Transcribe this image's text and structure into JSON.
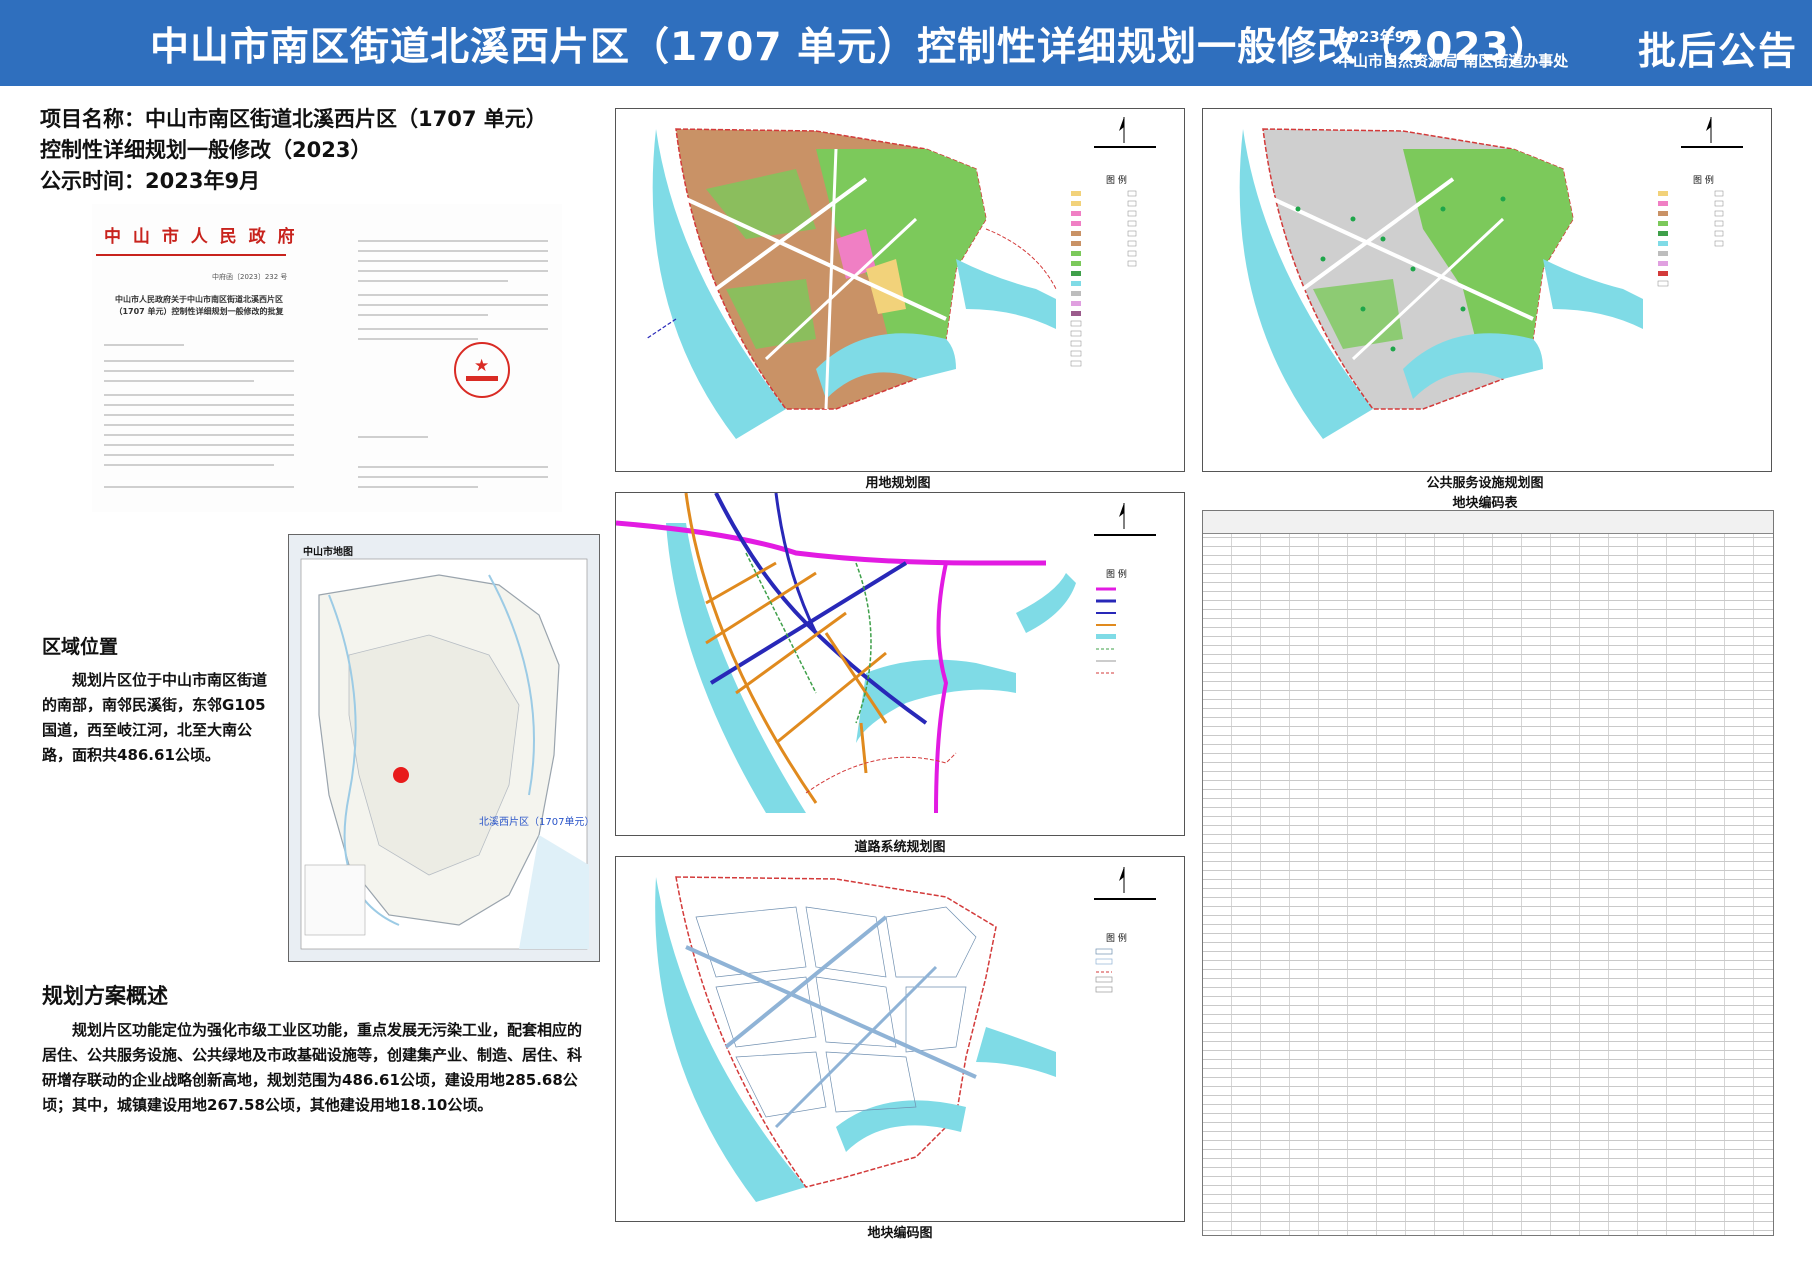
{
  "header": {
    "title": "中山市南区街道北溪西片区（1707 单元）控制性详细规划一般修改（2023）",
    "date": "2023年9月",
    "org": "中山市自然资源局 南区街道办事处",
    "badge": "批后公告"
  },
  "project": {
    "name_line1": "项目名称：中山市南区街道北溪西片区（1707 单元）",
    "name_line2": "控制性详细规划一般修改（2023）",
    "time": "公示时间：2023年9月"
  },
  "document": {
    "issuer": "中 山 市 人 民 政 府",
    "number": "中府函〔2023〕232 号",
    "title": "中山市人民政府关于中山市南区街道北溪西片区（1707 单元）控制性详细规划一般修改的批复"
  },
  "location_map": {
    "title": "中山市地图",
    "label": "北溪西片区（1707单元）"
  },
  "region": {
    "heading": "区域位置",
    "text": "规划片区位于中山市南区街道的南部，南邻民溪街，东邻G105国道，西至岐江河，北至大南公路，面积共486.61公顷。"
  },
  "overview": {
    "heading": "规划方案概述",
    "text": "规划片区功能定位为强化市级工业区功能，重点发展无污染工业，配套相应的居住、公共服务设施、公共绿地及市政基础设施等，创建集产业、制造、居住、科研增存联动的企业战略创新高地，规划范围为486.61公顷，建设用地285.68公顷；其中，城镇建设用地267.58公顷，其他建设用地18.10公顷。"
  },
  "maps": {
    "land_use": "用地规划图",
    "public_service": "公共服务设施规划图",
    "road_system": "道路系统规划图",
    "parcel_code": "地块编码图",
    "legend": "图 例"
  },
  "table": {
    "title": "地块编码表"
  },
  "colors": {
    "header_bg": "#2f6fbe",
    "water": "#7fdbe6",
    "industrial": "#c99266",
    "green": "#7cc95b",
    "boundary_red": "#d33a3a",
    "arterial": "#e21be2",
    "main_road": "#2828b8",
    "secondary_road": "#e08a1e"
  }
}
